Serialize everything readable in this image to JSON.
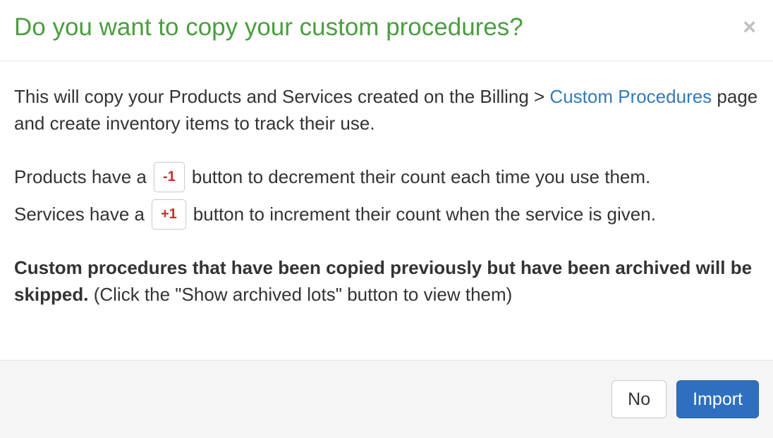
{
  "header": {
    "title": "Do you want to copy your custom procedures?"
  },
  "body": {
    "intro_before": "This will copy your Products and Services created on the Billing > ",
    "intro_link": "Custom Procedures",
    "intro_after": " page and create inventory items to track their use.",
    "products_before": "Products have a ",
    "products_chip": "-1",
    "products_after": " button to decrement their count each time you use them.",
    "services_before": "Services have a ",
    "services_chip": "+1",
    "services_after": " button to increment their count when the service is given.",
    "note_strong": "Custom procedures that have been copied previously but have been archived will be skipped.",
    "note_paren": " (Click the \"Show archived lots\" button to view them)"
  },
  "footer": {
    "no_label": "No",
    "import_label": "Import"
  }
}
